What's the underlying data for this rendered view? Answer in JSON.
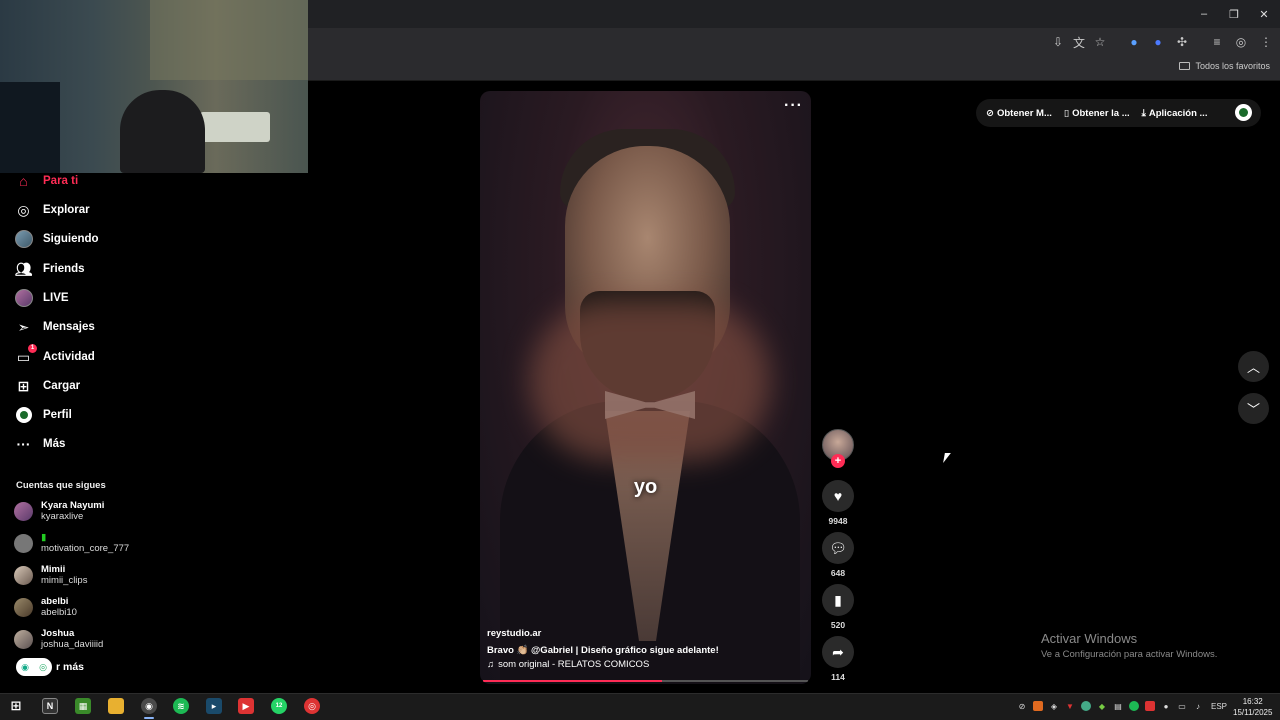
{
  "browser": {
    "bookmarks_folder": "Todos los favoritos",
    "window_controls": [
      "–",
      "❐",
      "✕"
    ]
  },
  "sidebar": {
    "items": [
      {
        "label": "Para ti",
        "icon": "home-icon",
        "active": true
      },
      {
        "label": "Explorar",
        "icon": "compass-icon"
      },
      {
        "label": "Siguiendo",
        "icon": "following-avatar-icon"
      },
      {
        "label": "Friends",
        "icon": "friends-icon"
      },
      {
        "label": "LIVE",
        "icon": "live-avatar-icon"
      },
      {
        "label": "Mensajes",
        "icon": "send-icon"
      },
      {
        "label": "Actividad",
        "icon": "activity-icon",
        "badge": "1"
      },
      {
        "label": "Cargar",
        "icon": "upload-icon"
      },
      {
        "label": "Perfil",
        "icon": "profile-icon"
      },
      {
        "label": "Más",
        "icon": "more-icon"
      }
    ],
    "following_header": "Cuentas que sigues",
    "accounts": [
      {
        "name": "Kyara Nayumi",
        "user": "kyaraxlive"
      },
      {
        "name": "▮",
        "user": "motivation_core_777"
      },
      {
        "name": "Mimii",
        "user": "mimii_clips"
      },
      {
        "name": "abelbi",
        "user": "abelbi10"
      },
      {
        "name": "Joshua",
        "user": "joshua_daviiiid"
      }
    ],
    "see_more": "r más"
  },
  "video": {
    "caption_overlay": "yo",
    "author": "reystudio.ar",
    "description": "Bravo 👏🏼 @Gabriel | Diseño gráfico  sigue adelante!",
    "sound": "som original - RELATOS COMICOS",
    "more": "···",
    "progress": 0.55
  },
  "actions": {
    "likes": "9948",
    "comments": "648",
    "saves": "520",
    "shares": "114"
  },
  "topbar": {
    "item1": "Obtener M...",
    "item2": "Obtener la ...",
    "item3": "Aplicación ..."
  },
  "watermark": {
    "title": "Activar Windows",
    "subtitle": "Ve a Configuración para activar Windows."
  },
  "taskbar": {
    "lang": "ESP",
    "time": "16:32",
    "date": "15/11/2025",
    "whatsapp_badge": "12"
  },
  "colors": {
    "accent": "#fe2c55",
    "background": "#000000",
    "taskbar": "#1b1b1b"
  }
}
